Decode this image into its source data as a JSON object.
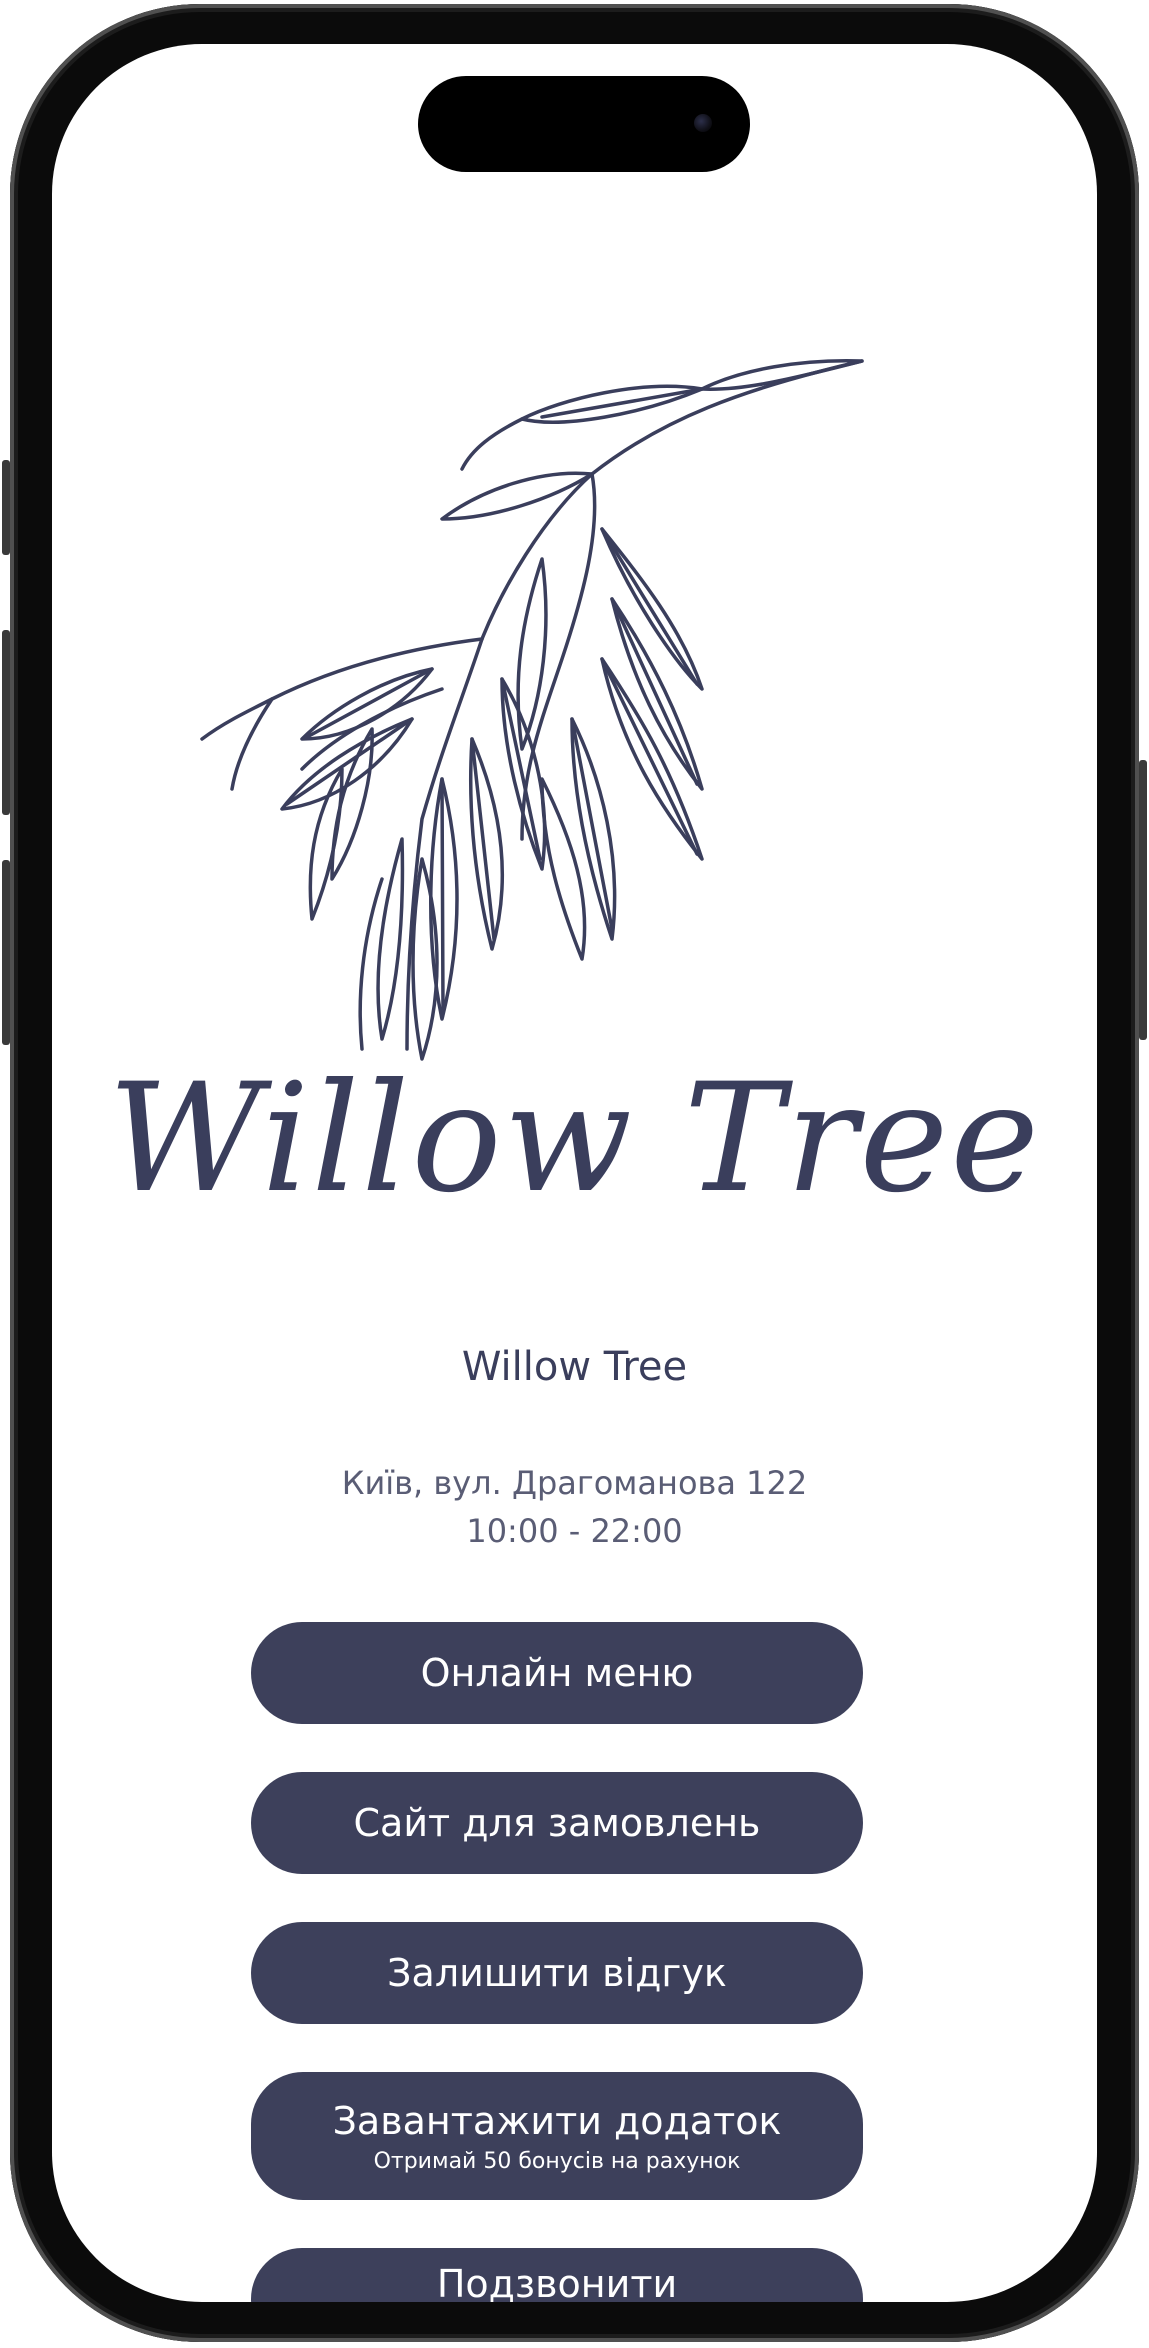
{
  "brand": {
    "wordmark": "Willow Tree",
    "ink_color": "#3a3e5c"
  },
  "venue": {
    "name": "Willow Tree",
    "address": "Київ, вул. Драгоманова 122",
    "hours": "10:00 - 22:00"
  },
  "buttons": {
    "menu": "Онлайн меню",
    "order_site": "Сайт для замовлень",
    "review": "Залишити відгук",
    "download_app": "Завантажити додаток",
    "download_app_sub": "Отримай 50 бонусів на рахунок",
    "call": "Подзвонити"
  },
  "colors": {
    "button_bg": "#3d405b",
    "button_text": "#ffffff",
    "frame": "#0b0b0b"
  }
}
